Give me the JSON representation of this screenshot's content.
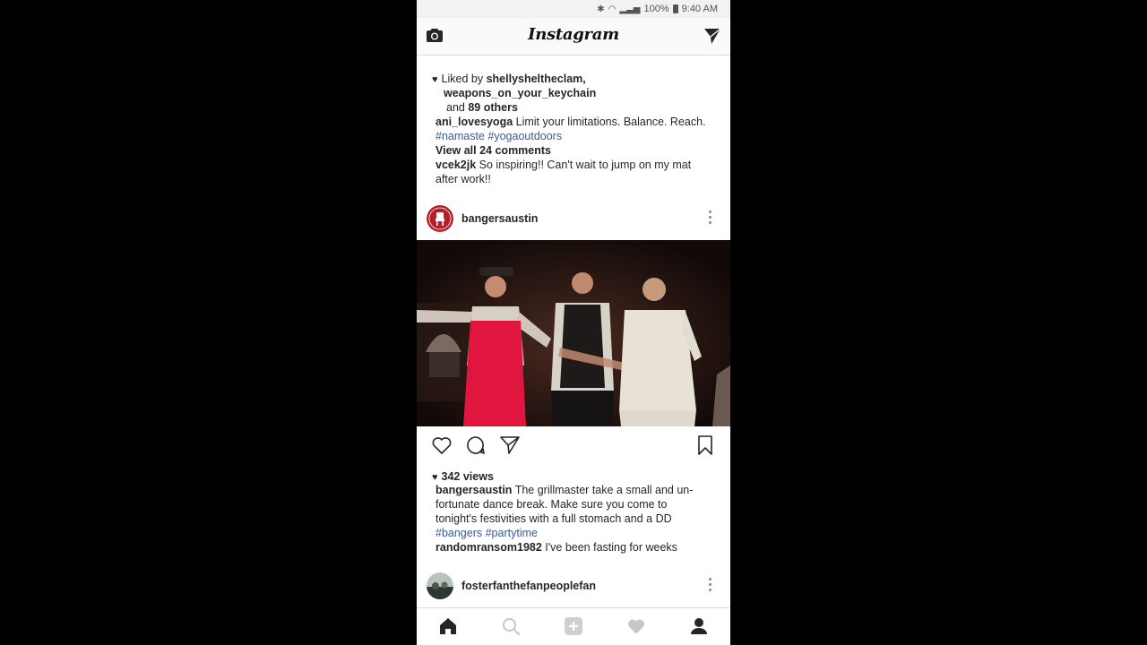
{
  "status_bar": {
    "battery": "100%",
    "time": "9:40 AM"
  },
  "header": {
    "title": "Instagram"
  },
  "previous_post": {
    "liked_by_prefix": "Liked by",
    "liked_by_user1": "shellysheltheclam,",
    "liked_by_user2": "weapons_on_your_keychain",
    "and_text": "and",
    "others_count": "89 others",
    "caption_user": "ani_lovesyoga",
    "caption_text": "Limit your limitations. Balance. Reach.",
    "hashtag1": "#namaste",
    "hashtag2": "#yogaoutdoors",
    "view_comments": "View all 24 comments",
    "comment_user": "vcek2jk",
    "comment_text_line1": "So inspiring!! Can't wait to jump on my mat",
    "comment_text_line2": "after work!!"
  },
  "post": {
    "username": "bangersaustin",
    "views": "342 views",
    "caption_user": "bangersaustin",
    "caption_line1": "The grillmaster take a small and un-",
    "caption_line2": "fortunate dance break. Make sure you come to",
    "caption_line3": "tonight's festivities with a full stomach and a DD",
    "hashtag1": "#bangers",
    "hashtag2": "#partytime",
    "comment_user": "randomransom1982",
    "comment_text": "I've been fasting for weeks"
  },
  "next_post": {
    "username": "fosterfanthefanpeoplefan"
  },
  "colors": {
    "hashtag": "#3b5a9a",
    "avatar_red": "#b41f28",
    "apron_red": "#e0163e"
  },
  "icons": {
    "camera": "camera-icon",
    "direct": "paper-plane-icon",
    "like": "heart-outline-icon",
    "comment": "comment-bubble-icon",
    "share": "paper-plane-icon",
    "save": "bookmark-icon",
    "nav_home": "home-icon",
    "nav_search": "search-icon",
    "nav_add": "plus-square-icon",
    "nav_activity": "heart-icon",
    "nav_profile": "person-icon"
  }
}
